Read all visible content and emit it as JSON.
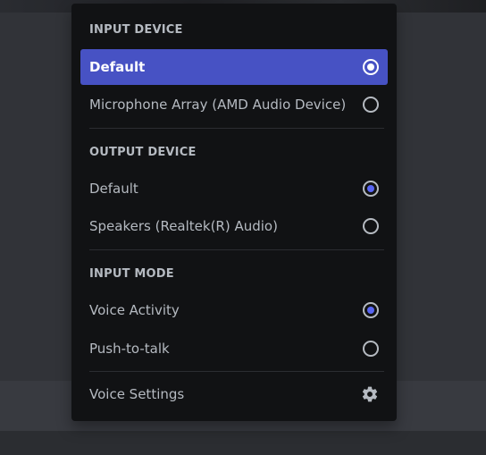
{
  "menu": {
    "input_device": {
      "header": "INPUT DEVICE",
      "options": [
        {
          "label": "Default",
          "selected": true
        },
        {
          "label": "Microphone Array (AMD Audio Device)",
          "selected": false
        }
      ]
    },
    "output_device": {
      "header": "OUTPUT DEVICE",
      "options": [
        {
          "label": "Default",
          "selected": true
        },
        {
          "label": "Speakers (Realtek(R) Audio)",
          "selected": false
        }
      ]
    },
    "input_mode": {
      "header": "INPUT MODE",
      "options": [
        {
          "label": "Voice Activity",
          "selected": true
        },
        {
          "label": "Push-to-talk",
          "selected": false
        }
      ]
    },
    "voice_settings": {
      "label": "Voice Settings",
      "icon": "gear-icon"
    }
  },
  "colors": {
    "menu_background": "#111214",
    "highlight": "#4752c4",
    "radio_fill": "#5865f2",
    "text": "#b5bac1"
  }
}
